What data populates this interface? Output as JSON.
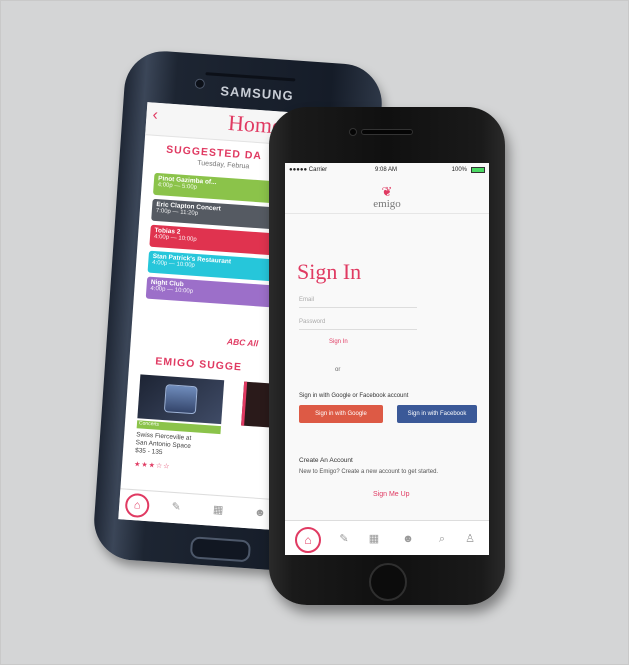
{
  "brand": {
    "samsung": "SAMSUNG",
    "accent_color": "#e03a62"
  },
  "back_phone": {
    "title": "Home",
    "back_icon": "chevron-left-icon",
    "suggested_heading": "SUGGESTED DA",
    "subheading": "Tuesday, Februa",
    "events": [
      {
        "title": "Pinot Gazimba of...",
        "time": "4:00p — 5:00p",
        "color": "#8bc34a"
      },
      {
        "title": "Eric Clapton Concert",
        "time": "7:00p — 11:20p",
        "color": "#555a62"
      },
      {
        "title": "Tobias 2",
        "time": "4:00p — 10:00p",
        "color": "#e0334f"
      },
      {
        "title": "Stan Patrick's Restaurant",
        "time": "4:00p — 10:00p",
        "color": "#26c6da"
      },
      {
        "title": "Night Club",
        "time": "4:00p — 10:00p",
        "color": "#9c6fc9"
      }
    ],
    "more_link": "ABC All",
    "emigo_heading": "EMIGO SUGGE",
    "card": {
      "tag": "Concerts",
      "line1": "Swiss Fierceville at",
      "line2": "San Antonio Space",
      "price": "$35 - 135",
      "rating": 3
    },
    "nav_icons": [
      "home-icon",
      "pencil-icon",
      "calendar-icon",
      "group-icon"
    ]
  },
  "front_phone": {
    "status": {
      "carrier": "●●●●● Carrier",
      "time": "9:08 AM",
      "battery": "100%"
    },
    "logo_text": "emigo",
    "sign_in_title": "Sign In",
    "email_placeholder": "Email",
    "password_placeholder": "Password",
    "sign_in_link": "Sign In",
    "or_text": "or",
    "social_label": "Sign in with Google or Facebook account",
    "google_button": "Sign in with Google",
    "facebook_button": "Sign in with Facebook",
    "create_title": "Create An Account",
    "create_sub": "New to Emigo? Create a new account to get started.",
    "sign_up_link": "Sign Me Up",
    "nav_icons": [
      "home-icon",
      "pencil-icon",
      "calendar-icon",
      "group-icon",
      "search-icon",
      "user-icon"
    ]
  }
}
